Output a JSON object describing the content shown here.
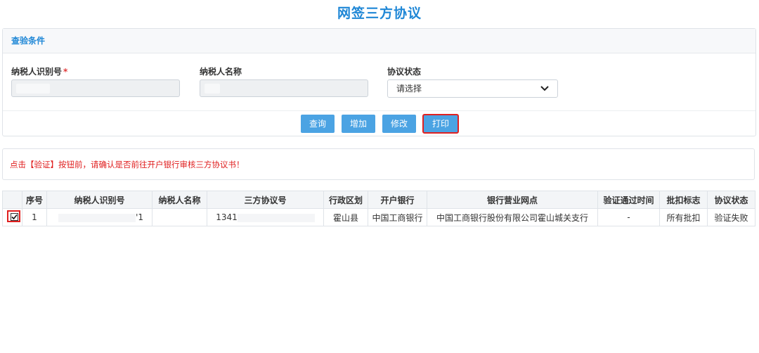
{
  "page": {
    "title": "网签三方协议"
  },
  "search_panel": {
    "header": "查验条件",
    "fields": [
      {
        "label": "纳税人识别号",
        "required_mark": "*",
        "value": ""
      },
      {
        "label": "纳税人名称",
        "value": ""
      },
      {
        "label": "协议状态",
        "selected": "请选择"
      }
    ],
    "buttons": {
      "query": "查询",
      "add": "增加",
      "edit": "修改",
      "print": "打印"
    }
  },
  "notice": "点击【验证】按钮前，请确认是否前往开户银行审核三方协议书！",
  "table": {
    "headers": [
      "",
      "序号",
      "纳税人识别号",
      "纳税人名称",
      "三方协议号",
      "行政区划",
      "开户银行",
      "银行营业网点",
      "验证通过时间",
      "批扣标志",
      "协议状态"
    ],
    "rows": [
      {
        "checked": true,
        "index": "1",
        "taxpayer_id_visible": "'1",
        "taxpayer_name": "",
        "agreement_no_visible": "1341",
        "region": "霍山县",
        "bank": "中国工商银行",
        "branch": "中国工商银行股份有限公司霍山城关支行",
        "verified_time": "-",
        "batch_flag": "所有批扣",
        "status": "验证失败"
      }
    ]
  },
  "colors": {
    "accent": "#1f87d6",
    "button": "#4ba3e3",
    "highlight": "#e02020",
    "notice": "#e02020"
  }
}
